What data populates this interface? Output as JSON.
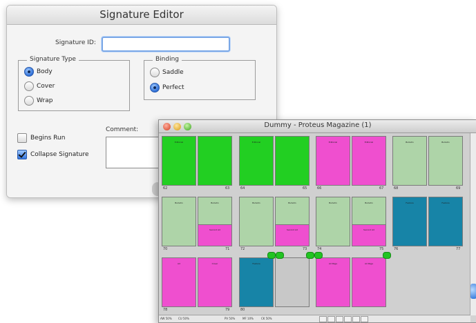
{
  "signature_editor": {
    "title": "Signature Editor",
    "signature_id": {
      "label": "Signature ID:",
      "value": ""
    },
    "signature_type": {
      "title": "Signature Type",
      "options": [
        {
          "label": "Body",
          "selected": true
        },
        {
          "label": "Cover",
          "selected": false
        },
        {
          "label": "Wrap",
          "selected": false
        }
      ]
    },
    "binding": {
      "title": "Binding",
      "options": [
        {
          "label": "Saddle",
          "selected": false
        },
        {
          "label": "Perfect",
          "selected": true
        }
      ]
    },
    "begins_run": {
      "label": "Begins Run",
      "checked": false
    },
    "collapse_signature": {
      "label": "Collapse Signature",
      "checked": true
    },
    "comment": {
      "label": "Comment:",
      "value": ""
    }
  },
  "proteus": {
    "title": "Dummy - Proteus Magazine (1)",
    "colors": {
      "green": "#22cf22",
      "light_green": "#aed4a8",
      "pink": "#ef4fcf",
      "teal": "#1784a7"
    },
    "rows": [
      [
        {
          "pages": [
            {
              "label": "Editorial",
              "color": "green"
            },
            {
              "label": "",
              "color": "green"
            }
          ],
          "nums": [
            "62",
            "63"
          ]
        },
        {
          "pages": [
            {
              "label": "Editorial",
              "color": "green"
            },
            {
              "label": "",
              "color": "green"
            }
          ],
          "nums": [
            "64",
            "65"
          ]
        },
        {
          "pages": [
            {
              "label": "Editorial",
              "color": "pink"
            },
            {
              "label": "Editorial",
              "color": "pink"
            }
          ],
          "nums": [
            "66",
            "67"
          ]
        },
        {
          "pages": [
            {
              "label": "Bulletin",
              "color": "light_green"
            },
            {
              "label": "Bulletin",
              "color": "light_green"
            }
          ],
          "nums": [
            "68",
            "69"
          ]
        }
      ],
      [
        {
          "pages": [
            {
              "label": "Bulletin",
              "color": "light_green"
            },
            {
              "label": "Bulletin",
              "color": "light_green",
              "box": "Second Ad"
            }
          ],
          "nums": [
            "70",
            "71"
          ]
        },
        {
          "pages": [
            {
              "label": "Bulletin",
              "color": "light_green"
            },
            {
              "label": "Bulletin",
              "color": "light_green",
              "box": "Second Ad"
            }
          ],
          "nums": [
            "72",
            "73"
          ]
        },
        {
          "pages": [
            {
              "label": "Bulletin",
              "color": "light_green"
            },
            {
              "label": "Bulletin",
              "color": "light_green",
              "box": "Second Ad"
            }
          ],
          "nums": [
            "74",
            "75"
          ]
        },
        {
          "pages": [
            {
              "label": "Feature",
              "color": "teal"
            },
            {
              "label": "Feature",
              "color": "teal"
            }
          ],
          "nums": [
            "76",
            "77"
          ]
        }
      ],
      [
        {
          "pages": [
            {
              "label": "Ad",
              "color": "pink"
            },
            {
              "label": "Cover",
              "color": "pink"
            }
          ],
          "nums": [
            "78",
            "79"
          ]
        },
        {
          "pages": [
            {
              "label": "Feature",
              "color": "teal"
            },
            {
              "label": "",
              "color": "gray"
            }
          ],
          "nums": [
            "80",
            ""
          ]
        },
        {
          "pages": [
            {
              "label": "Ad Page",
              "color": "pink"
            },
            {
              "label": "Ad Page",
              "color": "pink"
            }
          ],
          "nums": [
            "",
            ""
          ]
        }
      ]
    ],
    "status": [
      "AW 50%",
      "CU 50%",
      "PV 50%",
      "MF 10%",
      "CK 50%"
    ]
  }
}
